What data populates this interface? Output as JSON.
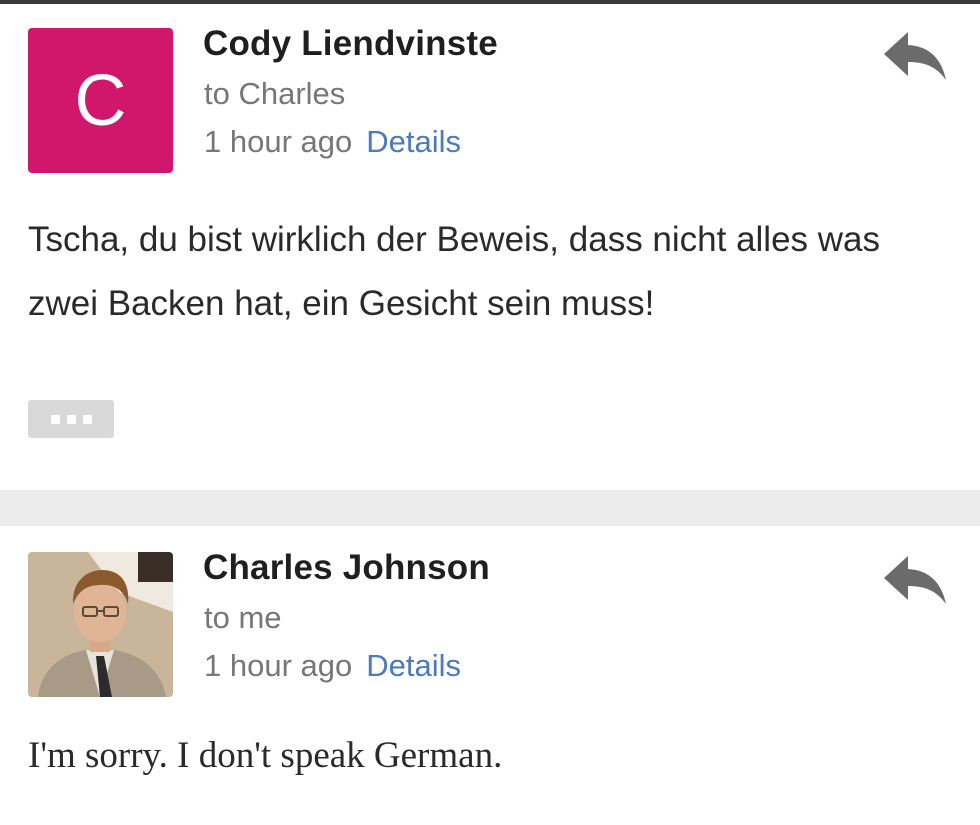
{
  "colors": {
    "avatar_bg": "#d0176b",
    "link": "#4a7bbf",
    "separator": "#ececec"
  },
  "messages": [
    {
      "sender": "Cody Liendvinste",
      "avatar_letter": "C",
      "recipient": "to Charles",
      "time": "1 hour ago",
      "details_label": "Details",
      "body": "Tscha, du bist wirklich der Beweis, dass nicht alles was zwei Backen hat, ein Gesicht sein muss!",
      "reply_icon": "reply-icon",
      "more_icon": "ellipsis-icon"
    },
    {
      "sender": "Charles Johnson",
      "avatar_icon": "profile-photo",
      "recipient": "to me",
      "time": "1 hour ago",
      "details_label": "Details",
      "body": "I'm sorry. I don't speak German.",
      "reply_icon": "reply-icon"
    }
  ]
}
